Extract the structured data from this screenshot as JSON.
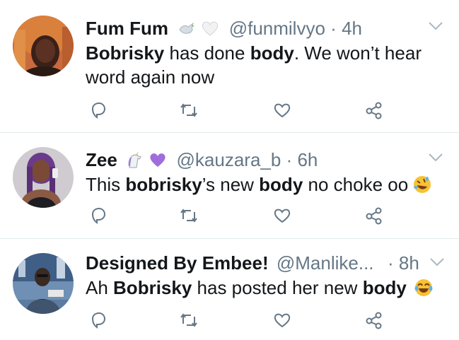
{
  "tweets": [
    {
      "name": "Fum Fum",
      "handle": "@funmilvyo",
      "dot": "·",
      "time": "4h",
      "emojis": [
        "dove-icon",
        "white-heart-icon"
      ],
      "text_parts": [
        "Bobrisky",
        " has done ",
        "body",
        ". We won’t hear word again now"
      ]
    },
    {
      "name": "Zee",
      "handle": "@kauzara_b",
      "dot": "·",
      "time": "6h",
      "emojis": [
        "unicorn-icon",
        "purple-heart-icon"
      ],
      "text_parts": [
        "This ",
        "bobrisky",
        "’s new ",
        "body",
        " no choke oo"
      ]
    },
    {
      "name": "Designed By Embee!",
      "handle": "@Manlike...",
      "dot": "·",
      "time": "8h",
      "emojis": [],
      "text_parts": [
        "Ah ",
        "Bobrisky",
        " has posted her new ",
        "body"
      ]
    }
  ],
  "actions": [
    "reply-icon",
    "retweet-icon",
    "like-icon",
    "share-icon"
  ],
  "colors": {
    "text": "#14171a",
    "secondary": "#657786",
    "divider": "#e1e8ed",
    "purple_heart": "#a06ddc"
  }
}
